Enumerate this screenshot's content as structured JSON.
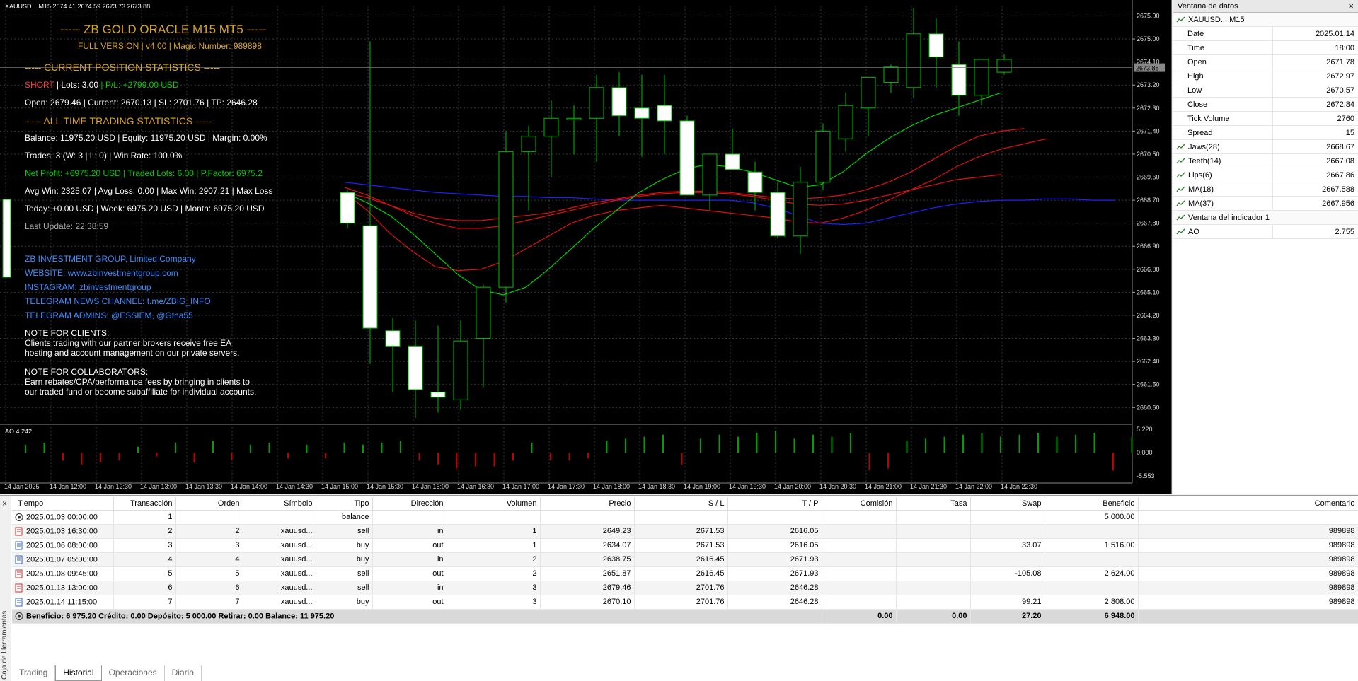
{
  "chart_header": "XAUUSD...,M15  2674.41 2674.59 2673.73 2673.88",
  "ea": {
    "title": "----- ZB GOLD ORACLE M15 MT5 -----",
    "subtitle": "FULL VERSION | v4.00 | Magic Number: 989898",
    "current_header": "----- CURRENT POSITION STATISTICS -----",
    "pos_type": "SHORT",
    "pos_lots": " | Lots: 3.00 ",
    "pos_pl": "| P/L: +2799.00 USD",
    "pos_detail": "Open: 2679.46 | Current: 2670.13 | SL: 2701.76 | TP: 2646.28",
    "alltime_header": "----- ALL TIME TRADING STATISTICS -----",
    "balance_line": "Balance: 11975.20 USD | Equity: 11975.20 USD | Margin: 0.00%",
    "trades_line": "Trades: 3 (W: 3 | L: 0) | Win Rate: 100.0%",
    "net_line": "Net Profit: +6975.20 USD | Traded Lots: 6.00 | P.Factor: 6975.2",
    "avg_line": "Avg Win: 2325.07 | Avg Loss: 0.00 | Max Win: 2907.21 | Max Loss",
    "today_line": "Today: +0.00 USD | Week: 6975.20 USD | Month: 6975.20 USD",
    "last_update": "Last Update: 22:38:59",
    "company": "ZB INVESTMENT GROUP, Limited Company",
    "website": "WEBSITE: www.zbinvestmentgroup.com",
    "instagram": "INSTAGRAM: zbinvestmentgroup",
    "telegram_news": "TELEGRAM NEWS CHANNEL: t.me/ZBIG_INFO",
    "telegram_admins": "TELEGRAM ADMINS: @ESSIEM, @Gtha55",
    "note_clients_title": "NOTE FOR CLIENTS:",
    "note_clients_1": "Clients trading with our partner brokers receive free EA",
    "note_clients_2": "hosting and account management on our private servers.",
    "note_collab_title": "NOTE FOR COLLABORATORS:",
    "note_collab_1": "Earn rebates/CPA/performance fees by bringing in clients to",
    "note_collab_2": "our traded fund or become subaffiliate for individual accounts."
  },
  "ao_label": "AO 4.242",
  "chart_data": {
    "type": "candlestick",
    "price_ticks": [
      "2675.90",
      "2675.00",
      "2674.10",
      "2673.20",
      "2672.30",
      "2671.40",
      "2670.50",
      "2669.60",
      "2668.70",
      "2667.80",
      "2666.90",
      "2666.00",
      "2665.10",
      "2664.20",
      "2663.30",
      "2662.40",
      "2661.50",
      "2660.60"
    ],
    "current_price": "2673.88",
    "ao_ticks": [
      "5.220",
      "0.000",
      "-5.553"
    ],
    "time_ticks": [
      "14 Jan 2025",
      "14 Jan 12:00",
      "14 Jan 12:30",
      "14 Jan 13:00",
      "14 Jan 13:30",
      "14 Jan 14:00",
      "14 Jan 14:30",
      "14 Jan 15:00",
      "14 Jan 15:30",
      "14 Jan 16:00",
      "14 Jan 16:30",
      "14 Jan 17:00",
      "14 Jan 17:30",
      "14 Jan 18:00",
      "14 Jan 18:30",
      "14 Jan 19:00",
      "14 Jan 19:30",
      "14 Jan 20:00",
      "14 Jan 20:30",
      "14 Jan 21:00",
      "14 Jan 21:30",
      "14 Jan 22:00",
      "14 Jan 22:30"
    ],
    "candles": [
      {
        "o": 2669.0,
        "h": 2669.1,
        "l": 2667.6,
        "c": 2667.8
      },
      {
        "o": 2667.7,
        "h": 2674.9,
        "l": 2662.3,
        "c": 2663.7
      },
      {
        "o": 2663.6,
        "h": 2664.1,
        "l": 2661.2,
        "c": 2663.0
      },
      {
        "o": 2663.0,
        "h": 2664.0,
        "l": 2660.2,
        "c": 2661.3
      },
      {
        "o": 2661.2,
        "h": 2663.8,
        "l": 2660.4,
        "c": 2661.0
      },
      {
        "o": 2660.9,
        "h": 2664.0,
        "l": 2660.5,
        "c": 2663.2
      },
      {
        "o": 2663.3,
        "h": 2665.4,
        "l": 2661.4,
        "c": 2665.3
      },
      {
        "o": 2665.3,
        "h": 2671.4,
        "l": 2664.7,
        "c": 2670.6
      },
      {
        "o": 2670.6,
        "h": 2671.6,
        "l": 2668.3,
        "c": 2671.2
      },
      {
        "o": 2671.2,
        "h": 2672.6,
        "l": 2669.6,
        "c": 2671.9
      },
      {
        "o": 2671.9,
        "h": 2672.4,
        "l": 2670.5,
        "c": 2671.9
      },
      {
        "o": 2671.9,
        "h": 2673.6,
        "l": 2670.2,
        "c": 2673.1
      },
      {
        "o": 2673.1,
        "h": 2673.7,
        "l": 2671.2,
        "c": 2672.0
      },
      {
        "o": 2672.3,
        "h": 2673.6,
        "l": 2670.4,
        "c": 2671.9
      },
      {
        "o": 2672.4,
        "h": 2673.6,
        "l": 2670.5,
        "c": 2671.8
      },
      {
        "o": 2671.8,
        "h": 2672.0,
        "l": 2669.1,
        "c": 2668.9
      },
      {
        "o": 2668.9,
        "h": 2670.3,
        "l": 2668.3,
        "c": 2670.5
      },
      {
        "o": 2670.5,
        "h": 2671.5,
        "l": 2669.9,
        "c": 2669.9
      },
      {
        "o": 2669.8,
        "h": 2670.2,
        "l": 2668.3,
        "c": 2669.0
      },
      {
        "o": 2669.0,
        "h": 2669.4,
        "l": 2667.2,
        "c": 2667.3
      },
      {
        "o": 2667.3,
        "h": 2670.0,
        "l": 2666.6,
        "c": 2669.4
      },
      {
        "o": 2669.4,
        "h": 2671.7,
        "l": 2669.1,
        "c": 2671.4
      },
      {
        "o": 2671.1,
        "h": 2672.9,
        "l": 2670.6,
        "c": 2672.4
      },
      {
        "o": 2672.3,
        "h": 2673.5,
        "l": 2671.2,
        "c": 2673.5
      },
      {
        "o": 2673.3,
        "h": 2674.0,
        "l": 2672.9,
        "c": 2673.9
      },
      {
        "o": 2673.1,
        "h": 2676.2,
        "l": 2672.7,
        "c": 2675.2
      },
      {
        "o": 2675.2,
        "h": 2675.8,
        "l": 2673.1,
        "c": 2674.3
      },
      {
        "o": 2674.0,
        "h": 2674.9,
        "l": 2672.0,
        "c": 2672.8
      },
      {
        "o": 2672.8,
        "h": 2674.2,
        "l": 2672.4,
        "c": 2674.2
      },
      {
        "o": 2673.7,
        "h": 2674.4,
        "l": 2673.6,
        "c": 2674.2
      }
    ],
    "lines": {
      "blue_ma": [
        2669.4,
        2669.3,
        2669.2,
        2669.1,
        2669.0,
        2668.95,
        2668.9,
        2668.85,
        2668.85,
        2668.8,
        2668.8,
        2668.75,
        2668.7,
        2668.7,
        2668.7,
        2668.7,
        2668.7,
        2668.7,
        2668.6,
        2668.4,
        2668.1,
        2667.8,
        2667.75,
        2667.8,
        2668.0,
        2668.2,
        2668.4,
        2668.55,
        2668.65,
        2668.7,
        2668.7,
        2668.75,
        2668.75,
        2668.7,
        2668.7
      ],
      "red_ma_1": [
        2669.0,
        2668.3,
        2667.4,
        2666.7,
        2666.1,
        2665.95,
        2666.0,
        2666.3,
        2666.8,
        2667.3,
        2667.8,
        2668.1,
        2668.3,
        2668.4,
        2668.5,
        2668.4,
        2668.3,
        2668.2,
        2668.1,
        2668.0,
        2667.85,
        2667.8,
        2668.0,
        2668.3,
        2668.7,
        2669.1,
        2669.5,
        2670.0,
        2670.4,
        2670.7,
        2670.9,
        2671.1
      ],
      "red_ma_2": [
        2669.0,
        2668.8,
        2668.5,
        2668.2,
        2668.0,
        2667.9,
        2667.9,
        2668.0,
        2668.1,
        2668.2,
        2668.4,
        2668.6,
        2668.75,
        2668.9,
        2669.0,
        2669.05,
        2669.05,
        2669.0,
        2668.9,
        2668.8,
        2668.75,
        2668.8,
        2668.9,
        2669.1,
        2669.4,
        2669.8,
        2670.3,
        2670.8,
        2671.2,
        2671.4,
        2671.5
      ],
      "red_ma_3": [
        2669.2,
        2668.9,
        2668.5,
        2668.1,
        2667.8,
        2667.6,
        2667.6,
        2667.7,
        2667.9,
        2668.1,
        2668.3,
        2668.5,
        2668.7,
        2668.85,
        2668.95,
        2669.0,
        2669.0,
        2668.95,
        2668.85,
        2668.7,
        2668.55,
        2668.5,
        2668.55,
        2668.7,
        2668.9,
        2669.1,
        2669.3,
        2669.5,
        2669.6,
        2669.7
      ],
      "green_ma": [
        2669.0,
        2668.6,
        2668.1,
        2667.4,
        2666.6,
        2665.8,
        2665.2,
        2665.0,
        2665.3,
        2666.0,
        2666.8,
        2667.6,
        2668.3,
        2669.0,
        2669.5,
        2669.9,
        2670.1,
        2670.0,
        2669.8,
        2669.5,
        2669.2,
        2669.3,
        2669.8,
        2670.5,
        2671.1,
        2671.6,
        2672.0,
        2672.3,
        2672.6,
        2672.9
      ]
    },
    "ao_bars": [
      0.4,
      0.5,
      -0.4,
      -0.6,
      -0.5,
      -0.4,
      0.3,
      -0.2,
      0.5,
      -0.5,
      0.6,
      -0.4,
      0.4,
      0.5,
      -0.3,
      0.4,
      -0.3,
      0.5,
      0.4,
      0.5,
      0.6,
      -0.4,
      -0.6,
      -0.8,
      -0.7,
      -0.7,
      -0.4,
      0.5,
      -0.4,
      -0.4,
      -0.3,
      0.6,
      0.7,
      0.8,
      0.9,
      -0.6,
      0.7,
      0.9,
      0.8,
      1.0,
      1.1,
      0.7,
      0.9,
      0.8,
      1.0,
      -0.9,
      -0.8,
      0.6,
      0.7,
      0.8,
      0.9,
      1.0,
      0.8,
      0.9,
      1.0,
      0.8,
      0.9,
      1.0,
      -0.9,
      0.8
    ]
  },
  "data_window": {
    "title": "Ventana de datos",
    "close": "×",
    "symbol": "XAUUSD...,M15",
    "rows": [
      {
        "k": "Date",
        "v": "2025.01.14"
      },
      {
        "k": "Time",
        "v": "18:00"
      },
      {
        "k": "Open",
        "v": "2671.78"
      },
      {
        "k": "High",
        "v": "2672.97"
      },
      {
        "k": "Low",
        "v": "2670.57"
      },
      {
        "k": "Close",
        "v": "2672.84"
      },
      {
        "k": "Tick Volume",
        "v": "2760"
      },
      {
        "k": "Spread",
        "v": "15"
      }
    ],
    "indicators": [
      {
        "k": "Jaws(28)",
        "v": "2668.67"
      },
      {
        "k": "Teeth(14)",
        "v": "2667.08"
      },
      {
        "k": "Lips(6)",
        "v": "2667.86"
      },
      {
        "k": "MA(18)",
        "v": "2667.588"
      },
      {
        "k": "MA(37)",
        "v": "2667.956"
      }
    ],
    "subwindow_title": "Ventana del indicador 1",
    "ao": {
      "k": "AO",
      "v": "2.755"
    }
  },
  "terminal": {
    "close": "×",
    "side_label": "Caja de Herramientas",
    "columns": [
      "Tiempo",
      "Transacción",
      "Orden",
      "Símbolo",
      "Tipo",
      "Dirección",
      "Volumen",
      "Precio",
      "S / L",
      "T / P",
      "Comisión",
      "Tasa",
      "Swap",
      "Beneficio",
      "Comentario"
    ],
    "rows": [
      {
        "icon": "balance",
        "cells": [
          "2025.01.03 00:00:00",
          "1",
          "",
          "",
          "balance",
          "",
          "",
          "",
          "",
          "",
          "",
          "",
          "",
          "5 000.00",
          ""
        ]
      },
      {
        "icon": "sell",
        "cells": [
          "2025.01.03 16:30:00",
          "2",
          "2",
          "xauusd...",
          "sell",
          "in",
          "1",
          "2649.23",
          "2671.53",
          "2616.05",
          "",
          "",
          "",
          "",
          "989898"
        ]
      },
      {
        "icon": "buy",
        "cells": [
          "2025.01.06 08:00:00",
          "3",
          "3",
          "xauusd...",
          "buy",
          "out",
          "1",
          "2634.07",
          "2671.53",
          "2616.05",
          "",
          "",
          "33.07",
          "1 516.00",
          "989898"
        ]
      },
      {
        "icon": "buy",
        "cells": [
          "2025.01.07 05:00:00",
          "4",
          "4",
          "xauusd...",
          "buy",
          "in",
          "2",
          "2638.75",
          "2616.45",
          "2671.93",
          "",
          "",
          "",
          "",
          "989898"
        ]
      },
      {
        "icon": "sell",
        "cells": [
          "2025.01.08 09:45:00",
          "5",
          "5",
          "xauusd...",
          "sell",
          "out",
          "2",
          "2651.87",
          "2616.45",
          "2671.93",
          "",
          "",
          "-105.08",
          "2 624.00",
          "989898"
        ]
      },
      {
        "icon": "sell",
        "cells": [
          "2025.01.13 13:00:00",
          "6",
          "6",
          "xauusd...",
          "sell",
          "in",
          "3",
          "2679.46",
          "2701.76",
          "2646.28",
          "",
          "",
          "",
          "",
          "989898"
        ]
      },
      {
        "icon": "buy",
        "cells": [
          "2025.01.14 11:15:00",
          "7",
          "7",
          "xauusd...",
          "buy",
          "out",
          "3",
          "2670.10",
          "2701.76",
          "2646.28",
          "",
          "",
          "99.21",
          "2 808.00",
          "989898"
        ]
      }
    ],
    "summary": {
      "text": "Beneficio: 6 975.20  Crédito: 0.00  Depósito: 5 000.00  Retirar: 0.00  Balance: 11 975.20",
      "comision": "0.00",
      "tasa": "0.00",
      "swap": "27.20",
      "beneficio": "6 948.00"
    },
    "tabs": [
      "Trading",
      "Historial",
      "Operaciones",
      "Diario"
    ],
    "active_tab": "Historial"
  },
  "colors": {
    "bull": "#ffffff",
    "bear": "#ffffff",
    "wick": "#00c000",
    "blue_ma": "#1f1fff",
    "red_ma": "#e01010",
    "green_ma": "#00d000",
    "grid": "#3a3a3a"
  }
}
